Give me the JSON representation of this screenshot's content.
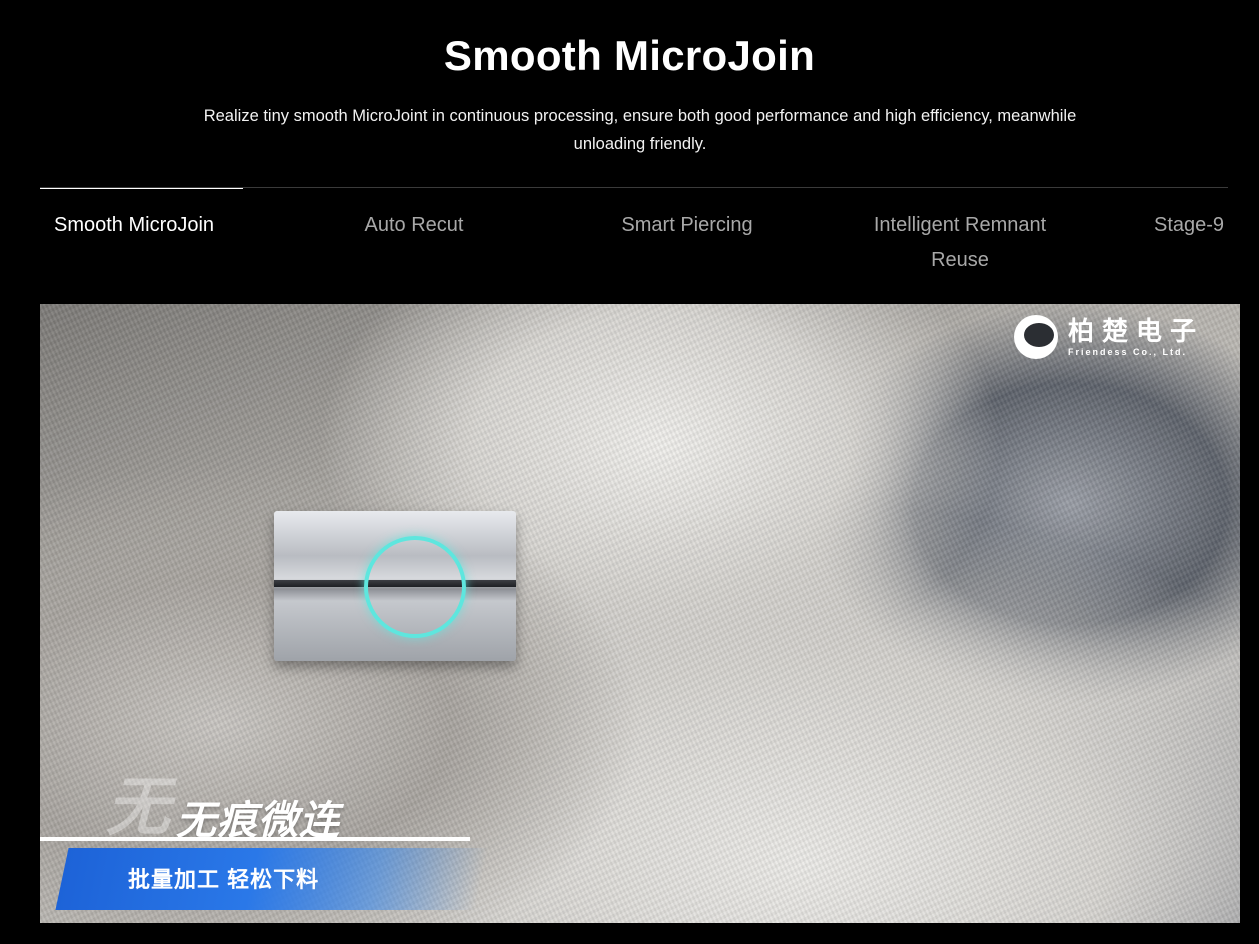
{
  "header": {
    "title": "Smooth MicroJoin",
    "subtitle": "Realize tiny smooth MicroJoint in continuous processing, ensure both good performance and high efficiency, meanwhile unloading friendly."
  },
  "tabs": [
    {
      "label": "Smooth MicroJoin",
      "active": true
    },
    {
      "label": "Auto Recut",
      "active": false
    },
    {
      "label": "Smart Piercing",
      "active": false
    },
    {
      "label": "Intelligent Remnant Reuse",
      "active": false
    },
    {
      "label": "Stage-9",
      "active": false
    }
  ],
  "media": {
    "logo_cn": "柏楚电子",
    "logo_en": "Friendess Co., Ltd.",
    "caption_big": "无",
    "caption_main": "无痕微连",
    "caption_sub": "批量加工 轻松下料",
    "highlight_color": "#5ee6de",
    "banner_color": "#1d63d8"
  }
}
